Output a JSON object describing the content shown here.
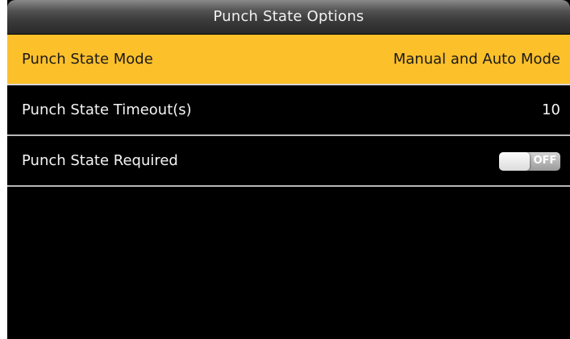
{
  "header": {
    "title": "Punch State Options"
  },
  "menu": {
    "items": [
      {
        "label": "Punch State Mode",
        "value": "Manual and Auto Mode",
        "selected": true
      },
      {
        "label": "Punch State Timeout(s)",
        "value": "10",
        "selected": false
      },
      {
        "label": "Punch State Required",
        "toggle_label": "OFF",
        "toggle_on": false,
        "selected": false
      }
    ]
  },
  "colors": {
    "selection_highlight": "#fcc02b",
    "background": "#000000",
    "divider": "#b8b8b8"
  }
}
